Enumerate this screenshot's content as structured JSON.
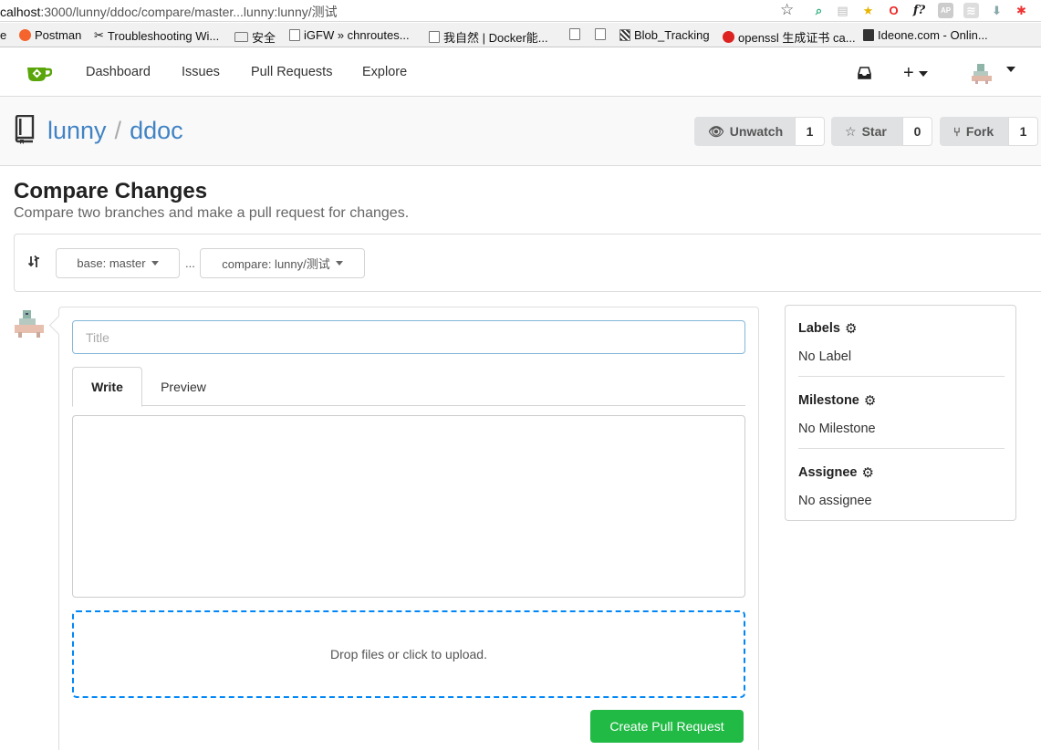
{
  "browser": {
    "url_prefix": "calhost",
    "url_rest": ":3000/lunny/ddoc/compare/master...lunny:lunny/测试",
    "bookmarks": [
      {
        "label": "e"
      },
      {
        "label": "Postman"
      },
      {
        "label": "Troubleshooting Wi..."
      },
      {
        "label": "安全"
      },
      {
        "label": "iGFW » chnroutes..."
      },
      {
        "label": "我自然 | Docker能..."
      },
      {
        "label": "Blob_Tracking"
      },
      {
        "label": "openssl 生成证书 ca..."
      },
      {
        "label": "Ideone.com - Onlin..."
      }
    ]
  },
  "nav": {
    "items": [
      "Dashboard",
      "Issues",
      "Pull Requests",
      "Explore"
    ],
    "plus": "+"
  },
  "repo": {
    "owner": "lunny",
    "separator": "/",
    "name": "ddoc",
    "watch_label": "Unwatch",
    "watch_count": "1",
    "star_label": "Star",
    "star_count": "0",
    "fork_label": "Fork",
    "fork_count": "1"
  },
  "page": {
    "title": "Compare Changes",
    "subtitle": "Compare two branches and make a pull request for changes."
  },
  "compare": {
    "base": "base: master",
    "ellipsis": "...",
    "head": "compare: lunny/测试"
  },
  "form": {
    "title_placeholder": "Title",
    "tab_write": "Write",
    "tab_preview": "Preview",
    "dropzone_text": "Drop files or click to upload.",
    "submit_label": "Create Pull Request"
  },
  "sidebar": {
    "labels_head": "Labels",
    "labels_value": "No Label",
    "milestone_head": "Milestone",
    "milestone_value": "No Milestone",
    "assignee_head": "Assignee",
    "assignee_value": "No assignee"
  },
  "colors": {
    "link": "#4183c4",
    "primary_green": "#21ba45",
    "dropzone_border": "#0087f7",
    "logo_green": "#5aa509"
  }
}
